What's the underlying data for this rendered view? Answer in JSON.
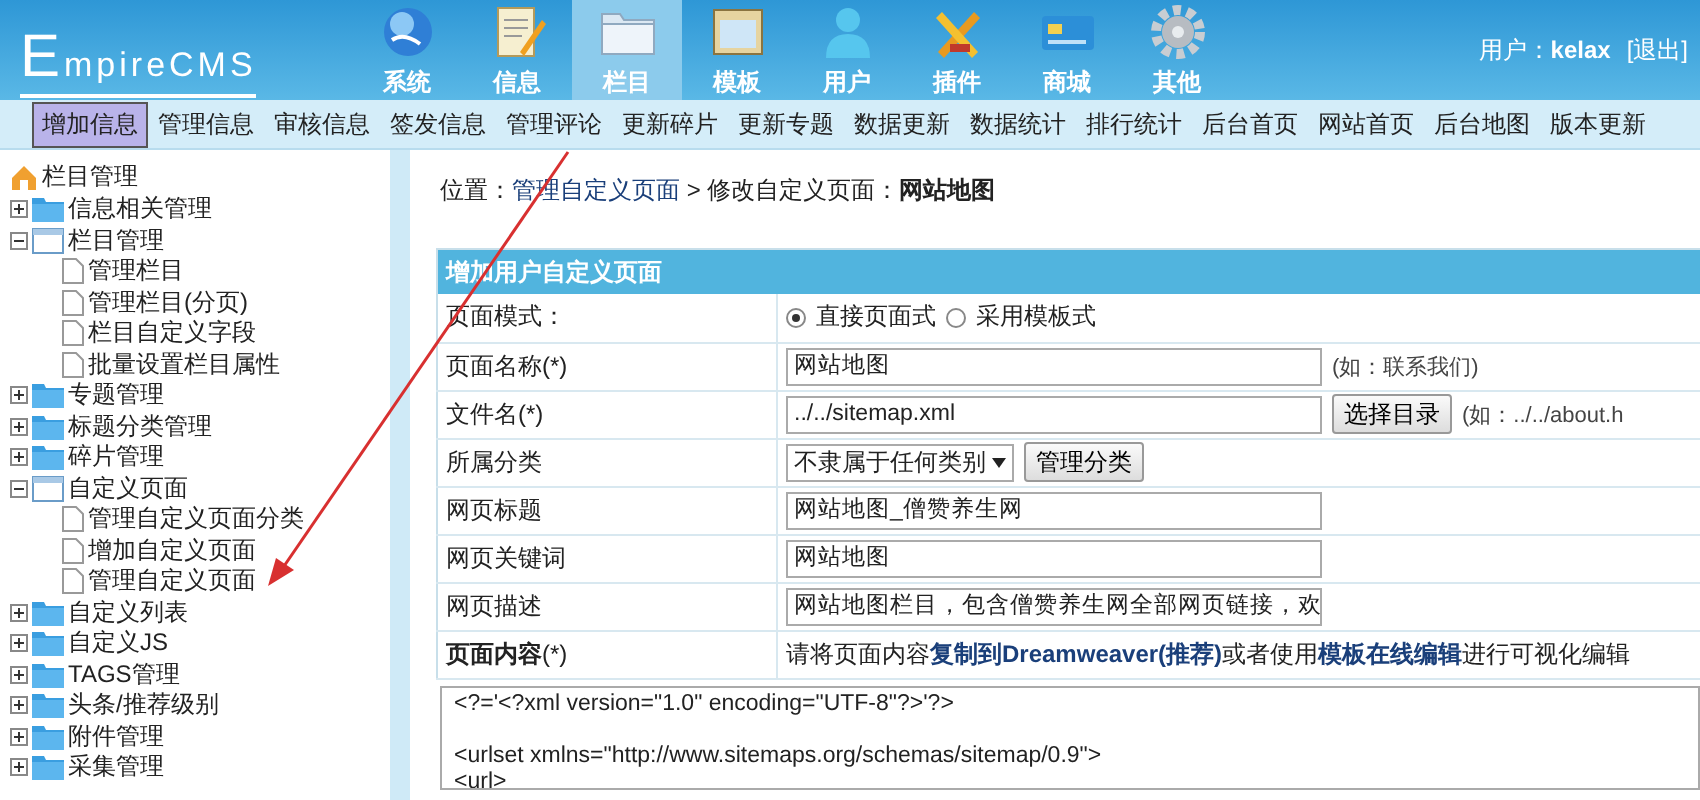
{
  "header": {
    "logo": "EmpireCMS",
    "nav": [
      {
        "label": "系统",
        "selected": false
      },
      {
        "label": "信息",
        "selected": false
      },
      {
        "label": "栏目",
        "selected": true
      },
      {
        "label": "模板",
        "selected": false
      },
      {
        "label": "用户",
        "selected": false
      },
      {
        "label": "插件",
        "selected": false
      },
      {
        "label": "商城",
        "selected": false
      },
      {
        "label": "其他",
        "selected": false
      }
    ],
    "user": "用户：**kelax**",
    "logout": "[退出]"
  },
  "subnav": [
    {
      "label": "增加信息",
      "selected": true
    },
    {
      "label": "管理信息",
      "selected": false
    },
    {
      "label": "审核信息",
      "selected": false
    },
    {
      "label": "签发信息",
      "selected": false
    },
    {
      "label": "管理评论",
      "selected": false
    },
    {
      "label": "更新碎片",
      "selected": false
    },
    {
      "label": "更新专题",
      "selected": false
    },
    {
      "label": "数据更新",
      "selected": false
    },
    {
      "label": "数据统计",
      "selected": false
    },
    {
      "label": "排行统计",
      "selected": false
    },
    {
      "label": "后台首页",
      "selected": false
    },
    {
      "label": "网站首页",
      "selected": false
    },
    {
      "label": "后台地图",
      "selected": false
    },
    {
      "label": "版本更新",
      "selected": false
    }
  ],
  "sidebar": {
    "title": "栏目管理",
    "items": [
      {
        "label": "信息相关管理",
        "expanded": false
      },
      {
        "label": "栏目管理",
        "expanded": true,
        "children": [
          {
            "label": "管理栏目"
          },
          {
            "label": "管理栏目(分页)"
          },
          {
            "label": "栏目自定义字段"
          },
          {
            "label": "批量设置栏目属性"
          }
        ]
      },
      {
        "label": "专题管理",
        "expanded": false
      },
      {
        "label": "标题分类管理",
        "expanded": false
      },
      {
        "label": "碎片管理",
        "expanded": false
      },
      {
        "label": "自定义页面",
        "expanded": true,
        "children": [
          {
            "label": "管理自定义页面分类"
          },
          {
            "label": "增加自定义页面"
          },
          {
            "label": "管理自定义页面"
          }
        ]
      },
      {
        "label": "自定义列表",
        "expanded": false
      },
      {
        "label": "自定义JS",
        "expanded": false
      },
      {
        "label": "TAGS管理",
        "expanded": false
      },
      {
        "label": "头条/推荐级别",
        "expanded": false
      },
      {
        "label": "附件管理",
        "expanded": false
      },
      {
        "label": "采集管理",
        "expanded": false
      }
    ]
  },
  "main": {
    "breadcrumb": {
      "prefix": "位置：",
      "link": "管理自定义页面",
      "rest": " > 修改自定义页面：",
      "current": "网站地图"
    },
    "form_title": "增加用户自定义页面",
    "rows": [
      {
        "label": "页面模式：",
        "kind": "radio",
        "options": [
          {
            "label": "直接页面式",
            "selected": true
          },
          {
            "label": "采用模板式",
            "selected": false
          }
        ]
      },
      {
        "label": "页面名称(*)",
        "kind": "input",
        "value": "网站地图",
        "hint": "(如：联系我们)"
      },
      {
        "label": "文件名(*)",
        "kind": "input",
        "value": "../../sitemap.xml",
        "button": "选择目录",
        "hint": "(如：../../about.h"
      },
      {
        "label": "所属分类",
        "kind": "select",
        "value": "不隶属于任何类别",
        "button": "管理分类"
      },
      {
        "label": "网页标题",
        "kind": "input",
        "value": "网站地图_僧赞养生网"
      },
      {
        "label": "网页关键词",
        "kind": "input",
        "value": "网站地图"
      },
      {
        "label": "网页描述",
        "kind": "input",
        "value": "网站地图栏目，包含僧赞养生网全部网页链接，欢"
      },
      {
        "label": "**页面内容**(*)",
        "kind": "note",
        "note": "请将页面内容**复制到Dreamweaver(推荐)**或者使用**模板在线编辑**进行可视化编辑"
      }
    ],
    "content": "<?='<?xml version=\"1.0\" encoding=\"UTF-8\"?>'?>\n\n<urlset xmlns=\"http://www.sitemaps.org/schemas/sitemap/0.9\">\n<url>"
  }
}
